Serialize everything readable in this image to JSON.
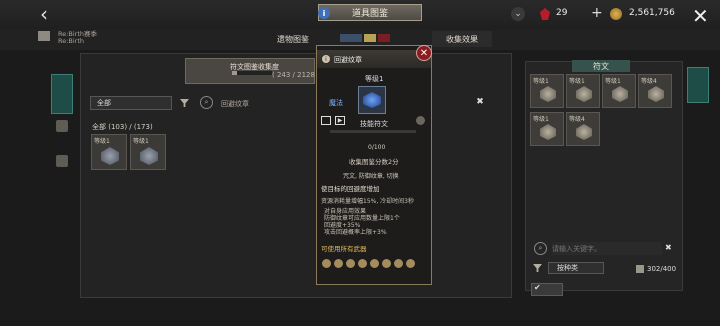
{
  "header": {
    "title": "道具图鉴",
    "gems": "29",
    "coins": "2,561,756"
  },
  "game": {
    "name_line1": "Re:Birth赛季",
    "name_line2": "Re:Birth"
  },
  "tabs": {
    "relic": "遗物图鉴",
    "effect": "收集效果"
  },
  "progress": {
    "title": "符文图鉴收集度",
    "count": "( 243 / 2128 )",
    "fraction": 0.114
  },
  "filters": {
    "category": "全部",
    "search_text": "回避纹章"
  },
  "collection": {
    "summary": "全部 (103) / (173)",
    "cards": [
      {
        "label": "等级1"
      },
      {
        "label": "等级1"
      }
    ]
  },
  "popup": {
    "name": "回避纹章",
    "level": "等级1",
    "class": "魔法",
    "type": "技能符文",
    "progress": "0/100",
    "progress_fraction": 0.0,
    "score": "收集图鉴分数2分",
    "tags": "咒文, 防御纹章, 切换",
    "target": "使目标的回避度增加",
    "cost": "资源消耗量增幅15%, 冷却时间3秒",
    "self_effects": [
      "对自身应用效果",
      "防御纹章可应用数量上限1个",
      "回避度+35%",
      "攻击回避概率上限+3%"
    ],
    "weapons": "可使用所有武器"
  },
  "right_panel": {
    "title": "符文",
    "slots": [
      {
        "label": "等级1"
      },
      {
        "label": "等级1"
      },
      {
        "label": "等级1"
      },
      {
        "label": "等级4"
      },
      {
        "label": "等级1"
      },
      {
        "label": "等级4"
      }
    ],
    "search_placeholder": "请输入关键字。",
    "sort": "按种类",
    "capacity": "302/400"
  }
}
